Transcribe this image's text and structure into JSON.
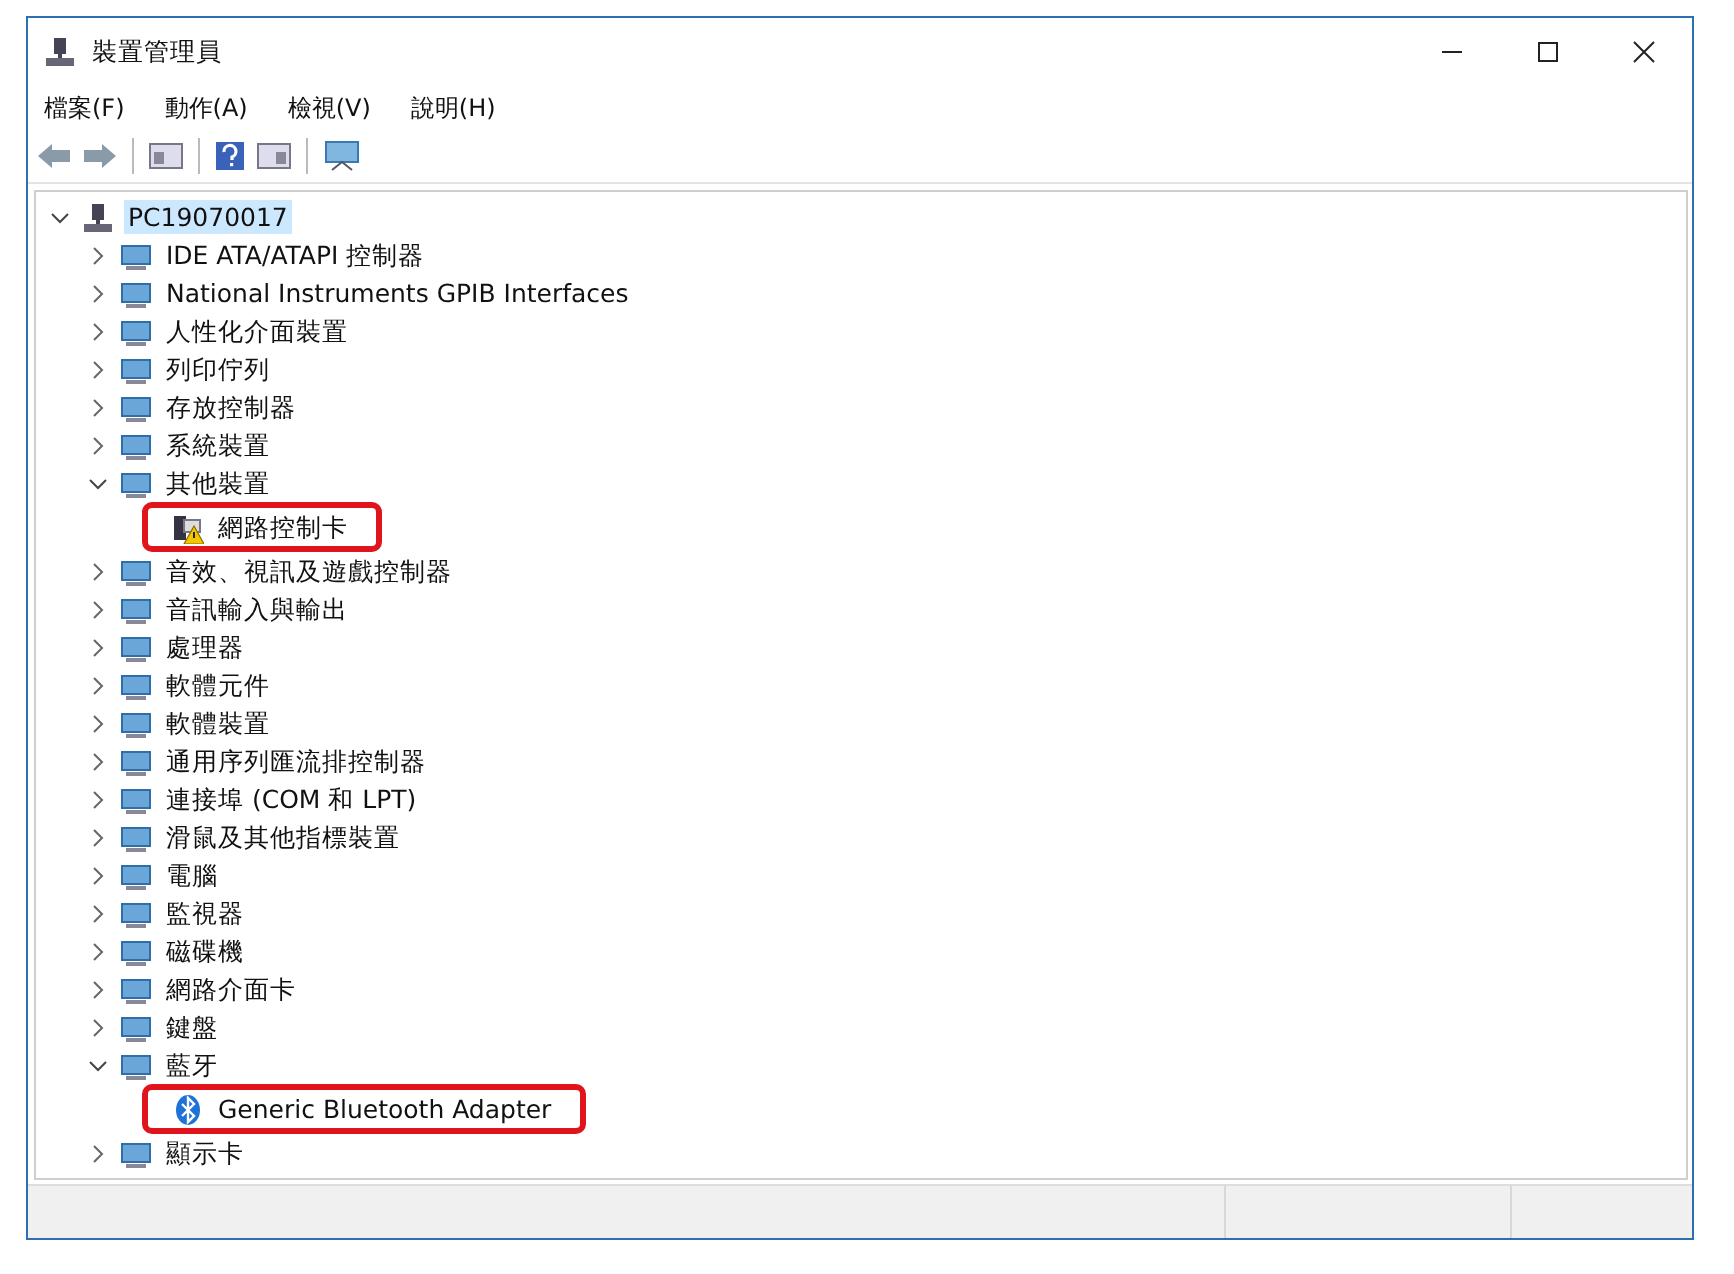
{
  "window": {
    "title": "裝置管理員"
  },
  "menu": [
    "檔案(F)",
    "動作(A)",
    "檢視(V)",
    "說明(H)"
  ],
  "tree": [
    {
      "label": "PC19070017",
      "expanded": true,
      "selected": true,
      "highlighted": false,
      "children": [
        {
          "label": "IDE ATA/ATAPI 控制器",
          "expanded": false,
          "selected": false,
          "highlighted": false
        },
        {
          "label": "National Instruments GPIB Interfaces",
          "expanded": false,
          "selected": false,
          "highlighted": false
        },
        {
          "label": "人性化介面裝置",
          "expanded": false,
          "selected": false,
          "highlighted": false
        },
        {
          "label": "列印佇列",
          "expanded": false,
          "selected": false,
          "highlighted": false
        },
        {
          "label": "存放控制器",
          "expanded": false,
          "selected": false,
          "highlighted": false
        },
        {
          "label": "系統裝置",
          "expanded": false,
          "selected": false,
          "highlighted": false
        },
        {
          "label": "其他裝置",
          "expanded": true,
          "selected": false,
          "highlighted": false,
          "children": [
            {
              "label": "網路控制卡",
              "selected": false,
              "highlighted": true,
              "warning": true
            }
          ]
        },
        {
          "label": "音效、視訊及遊戲控制器",
          "expanded": false,
          "selected": false,
          "highlighted": false
        },
        {
          "label": "音訊輸入與輸出",
          "expanded": false,
          "selected": false,
          "highlighted": false
        },
        {
          "label": "處理器",
          "expanded": false,
          "selected": false,
          "highlighted": false
        },
        {
          "label": "軟體元件",
          "expanded": false,
          "selected": false,
          "highlighted": false
        },
        {
          "label": "軟體裝置",
          "expanded": false,
          "selected": false,
          "highlighted": false
        },
        {
          "label": "通用序列匯流排控制器",
          "expanded": false,
          "selected": false,
          "highlighted": false
        },
        {
          "label": "連接埠 (COM 和 LPT)",
          "expanded": false,
          "selected": false,
          "highlighted": false
        },
        {
          "label": "滑鼠及其他指標裝置",
          "expanded": false,
          "selected": false,
          "highlighted": false
        },
        {
          "label": "電腦",
          "expanded": false,
          "selected": false,
          "highlighted": false
        },
        {
          "label": "監視器",
          "expanded": false,
          "selected": false,
          "highlighted": false
        },
        {
          "label": "磁碟機",
          "expanded": false,
          "selected": false,
          "highlighted": false
        },
        {
          "label": "網路介面卡",
          "expanded": false,
          "selected": false,
          "highlighted": false
        },
        {
          "label": "鍵盤",
          "expanded": false,
          "selected": false,
          "highlighted": false
        },
        {
          "label": "藍牙",
          "expanded": true,
          "selected": false,
          "highlighted": false,
          "children": [
            {
              "label": "Generic Bluetooth Adapter",
              "selected": false,
              "highlighted": true,
              "warning": false
            }
          ]
        },
        {
          "label": "顯示卡",
          "expanded": false,
          "selected": false,
          "highlighted": false
        }
      ]
    }
  ]
}
